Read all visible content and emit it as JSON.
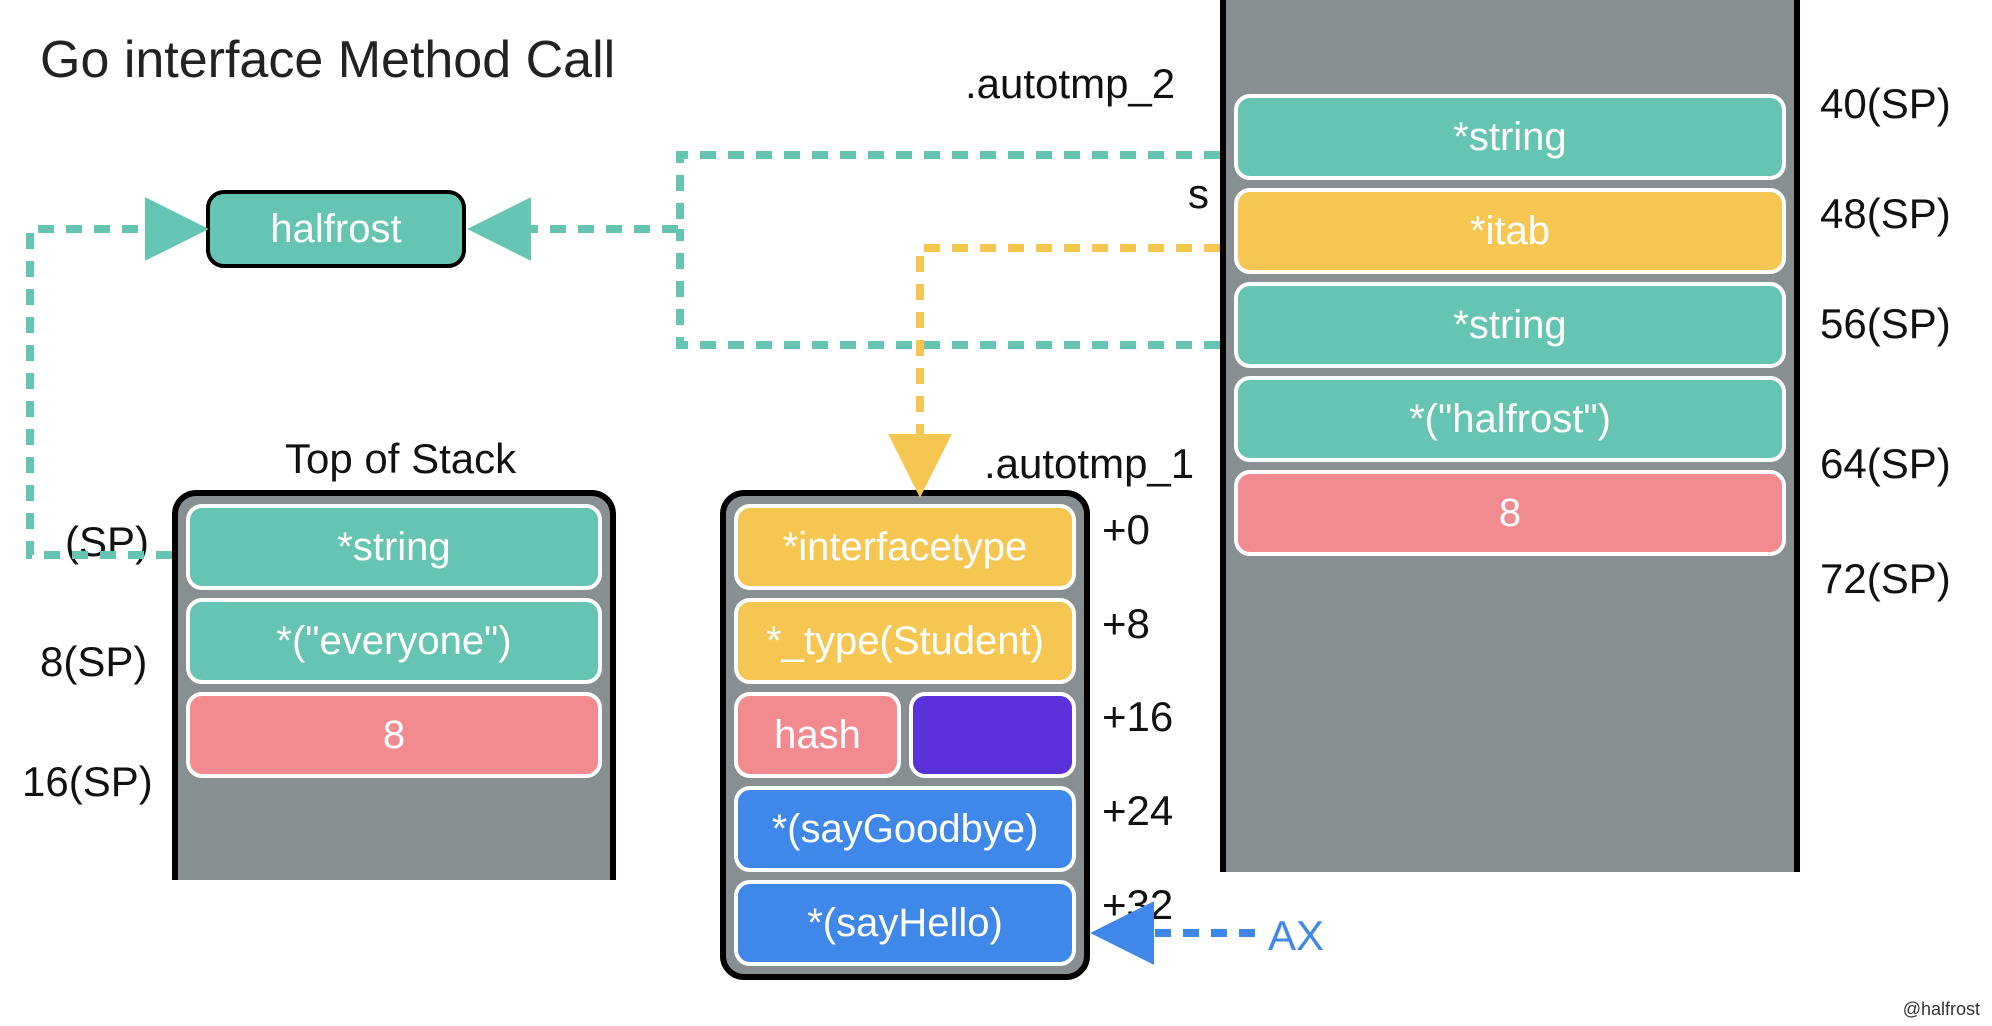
{
  "title": "Go interface Method Call",
  "credit": "@halfrost",
  "halfrost_bubble": "halfrost",
  "stack_left": {
    "caption": "Top of Stack",
    "offsets": [
      "(SP)",
      "8(SP)",
      "16(SP)"
    ],
    "cells": [
      {
        "label": "*string",
        "color": "teal"
      },
      {
        "label": "*(\"everyone\")",
        "color": "teal"
      },
      {
        "label": "8",
        "color": "pink"
      }
    ]
  },
  "itab": {
    "offsets": [
      "+0",
      "+8",
      "+16",
      "+24",
      "+32"
    ],
    "cells": [
      {
        "label": "*interfacetype",
        "color": "yellow"
      },
      {
        "label": "*_type(Student)",
        "color": "yellow"
      },
      {
        "split": true,
        "left": {
          "label": "hash",
          "color": "pink"
        },
        "right": {
          "label": "",
          "color": "purple"
        }
      },
      {
        "label": "*(sayGoodbye)",
        "color": "blue"
      },
      {
        "label": "*(sayHello)",
        "color": "blue"
      }
    ],
    "ax_label": "AX"
  },
  "stack_right": {
    "label_autotmp2": ".autotmp_2",
    "label_s": "s",
    "label_autotmp1": ".autotmp_1",
    "offsets": [
      "40(SP)",
      "48(SP)",
      "56(SP)",
      "64(SP)",
      "72(SP)"
    ],
    "cells": [
      {
        "label": "*string",
        "color": "teal"
      },
      {
        "label": "*itab",
        "color": "yellow"
      },
      {
        "label": "*string",
        "color": "teal"
      },
      {
        "label": "*(\"halfrost\")",
        "color": "teal"
      },
      {
        "label": "8",
        "color": "pink"
      }
    ]
  }
}
